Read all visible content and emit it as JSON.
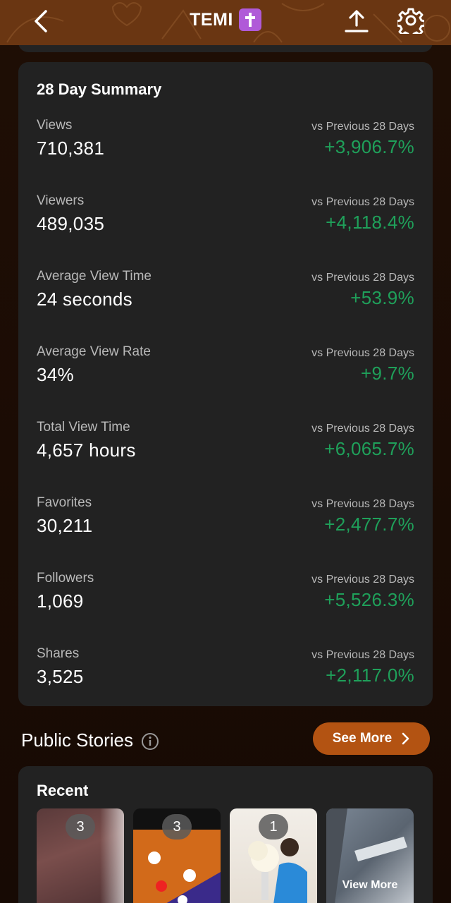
{
  "header": {
    "title": "TEMI",
    "badge_icon": "latin-cross-icon",
    "badge_color": "#b05ad8",
    "background": "#6a3612"
  },
  "summary": {
    "title": "28 Day Summary",
    "metrics": [
      {
        "label": "Views",
        "value": "710,381",
        "compare": "vs Previous 28 Days",
        "change": "+3,906.7%"
      },
      {
        "label": "Viewers",
        "value": "489,035",
        "compare": "vs Previous 28 Days",
        "change": "+4,118.4%"
      },
      {
        "label": "Average View Time",
        "value": "24 seconds",
        "compare": "vs Previous 28 Days",
        "change": "+53.9%"
      },
      {
        "label": "Average View Rate",
        "value": "34%",
        "compare": "vs Previous 28 Days",
        "change": "+9.7%"
      },
      {
        "label": "Total View Time",
        "value": "4,657 hours",
        "compare": "vs Previous 28 Days",
        "change": "+6,065.7%"
      },
      {
        "label": "Favorites",
        "value": "30,211",
        "compare": "vs Previous 28 Days",
        "change": "+2,477.7%"
      },
      {
        "label": "Followers",
        "value": "1,069",
        "compare": "vs Previous 28 Days",
        "change": "+5,526.3%"
      },
      {
        "label": "Shares",
        "value": "3,525",
        "compare": "vs Previous 28 Days",
        "change": "+2,117.0%"
      }
    ],
    "positive_color": "#1fa05a"
  },
  "public_stories": {
    "title": "Public Stories",
    "see_more_label": "See More",
    "button_color": "#b35312"
  },
  "recent": {
    "title": "Recent",
    "thumbnails": [
      {
        "count": "3"
      },
      {
        "count": "3"
      },
      {
        "count": "1"
      },
      {
        "label": "View More"
      }
    ]
  }
}
